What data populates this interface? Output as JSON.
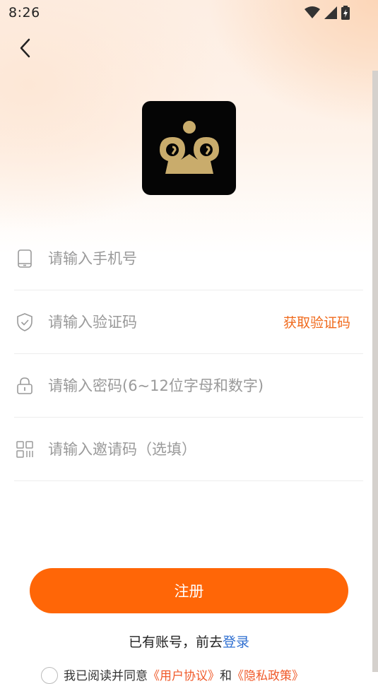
{
  "status_bar": {
    "time": "8:26",
    "icons": [
      "wifi-icon",
      "cellular-signal-icon",
      "battery-charging-icon"
    ]
  },
  "header": {
    "back_icon": "chevron-left-icon"
  },
  "logo": {
    "icon": "crown-logo-icon",
    "colors": {
      "background": "#050505",
      "gold": "#c9ac6c"
    }
  },
  "form": {
    "phone": {
      "placeholder": "请输入手机号",
      "icon": "mobile-phone-icon"
    },
    "code": {
      "placeholder": "请输入验证码",
      "icon": "shield-check-icon",
      "get_code_label": "获取验证码"
    },
    "password": {
      "placeholder": "请输入密码(6~12位字母和数字)",
      "icon": "lock-icon"
    },
    "invite": {
      "placeholder": "请输入邀请码（选填）",
      "icon": "qr-code-icon"
    }
  },
  "register": {
    "label": "注册"
  },
  "login_prompt": {
    "text": "已有账号，前去",
    "link": "登录"
  },
  "agreement": {
    "text": "我已阅读并同意",
    "doc1": "《用户协议》",
    "joiner": "和",
    "doc2": "《隐私政策》"
  },
  "colors": {
    "accent": "#ff6607",
    "link": "#2f6fd1",
    "get_code": "#f06a1c"
  }
}
